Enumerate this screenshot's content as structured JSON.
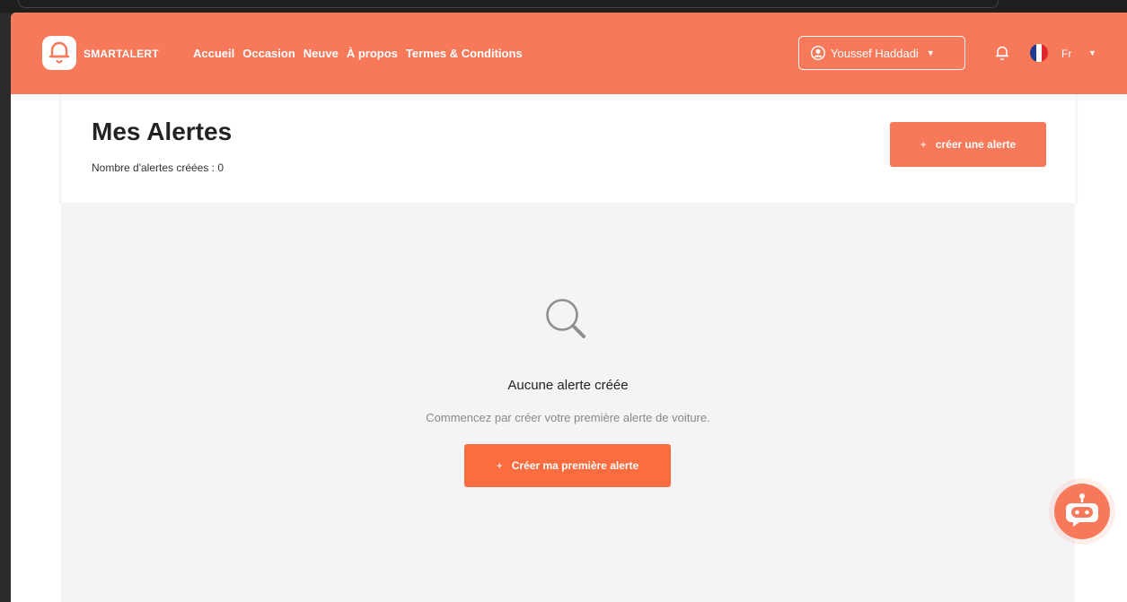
{
  "brand": {
    "name": "SMARTALERT"
  },
  "nav": {
    "links": [
      "Accueil",
      "Occasion",
      "Neuve",
      "À propos",
      "Termes & Conditions"
    ]
  },
  "user": {
    "name": "Youssef Haddadi",
    "icon": "user-circle-icon"
  },
  "language": {
    "code": "Fr",
    "flag": "flag-france-icon"
  },
  "page": {
    "title": "Mes Alertes",
    "count_text": "Nombre d'alertes créées : 0",
    "create_button": "créer une alerte"
  },
  "empty": {
    "title": "Aucune alerte créée",
    "subtitle": "Commencez par créer votre première alerte de voiture.",
    "button": "Créer ma première alerte"
  },
  "colors": {
    "accent": "#f7795a",
    "button": "#fb6c3f",
    "background": "#f4f4f7"
  }
}
